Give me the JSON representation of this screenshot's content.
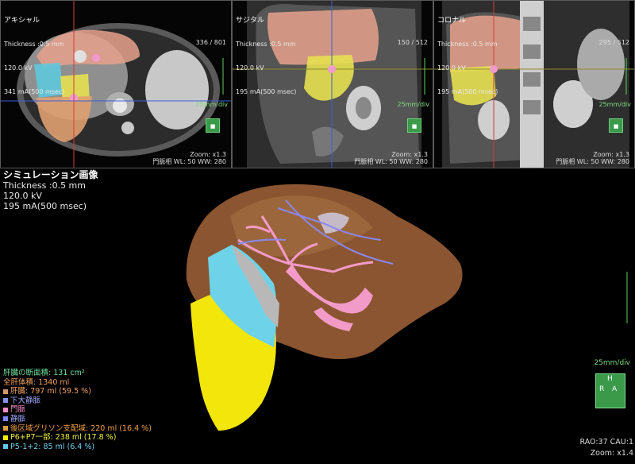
{
  "panes": [
    {
      "title": "アキシャル",
      "thickness": "Thickness :0.5 mm",
      "kv": "120.0 kV",
      "ma": "341 mA(500 msec)",
      "slice": "336 / 801",
      "scale": "25mm/div",
      "zoom": "Zoom: x1.3",
      "wl": "門脈相 WL: 50  WW: 280"
    },
    {
      "title": "サジタル",
      "thickness": "Thickness :0.5 mm",
      "kv": "120.0 kV",
      "ma": "195 mA(500 msec)",
      "slice": "150 / 512",
      "scale": "25mm/div",
      "zoom": "Zoom: x1.3",
      "wl": "門脈相 WL: 50  WW: 280"
    },
    {
      "title": "コロナル",
      "thickness": "Thickness :0.5 mm",
      "kv": "120.0 kV",
      "ma": "195 mA(500 msec)",
      "slice": "295 / 512",
      "scale": "25mm/div",
      "zoom": "Zoom: x1.3",
      "wl": "門脈相 WL: 50  WW: 280"
    }
  ],
  "simulation": {
    "title": "シミュレーション画像",
    "thickness": "Thickness :0.5 mm",
    "kv": "120.0 kV",
    "ma": "195 mA(500 msec)"
  },
  "legend": [
    {
      "text": "肝臓の断面積: 131 cm²",
      "color": "#6fe0a0",
      "swatch": ""
    },
    {
      "text": "全肝体積: 1340 ml",
      "color": "#f0a060",
      "swatch": ""
    },
    {
      "text": "肝臓: 797 ml (59.5 %)",
      "color": "#f0a060",
      "swatch": "#d9956a"
    },
    {
      "text": "下大静脈",
      "color": "#9fa8ff",
      "swatch": "#8a8ff0"
    },
    {
      "text": "門脈",
      "color": "#ff8fd0",
      "swatch": "#f08fc8"
    },
    {
      "text": "静脈",
      "color": "#9fa8ff",
      "swatch": "#7f88ff"
    },
    {
      "text": "後区域グリソン支配域: 220 ml (16.4 %)",
      "color": "#f0a040",
      "swatch": "#e0a040"
    },
    {
      "text": "P6+P7一部: 238 ml (17.8 %)",
      "color": "#f0f040",
      "swatch": "#f0f000"
    },
    {
      "text": "P5-1+2: 85 ml (6.4 %)",
      "color": "#70d0f0",
      "swatch": "#60c8e8"
    }
  ],
  "view3d": {
    "scale": "25mm/div",
    "orientation": "RAO:37 CAU:1",
    "zoom": "Zoom: x1.4",
    "cube_labels": [
      "R",
      "A",
      "H"
    ]
  }
}
